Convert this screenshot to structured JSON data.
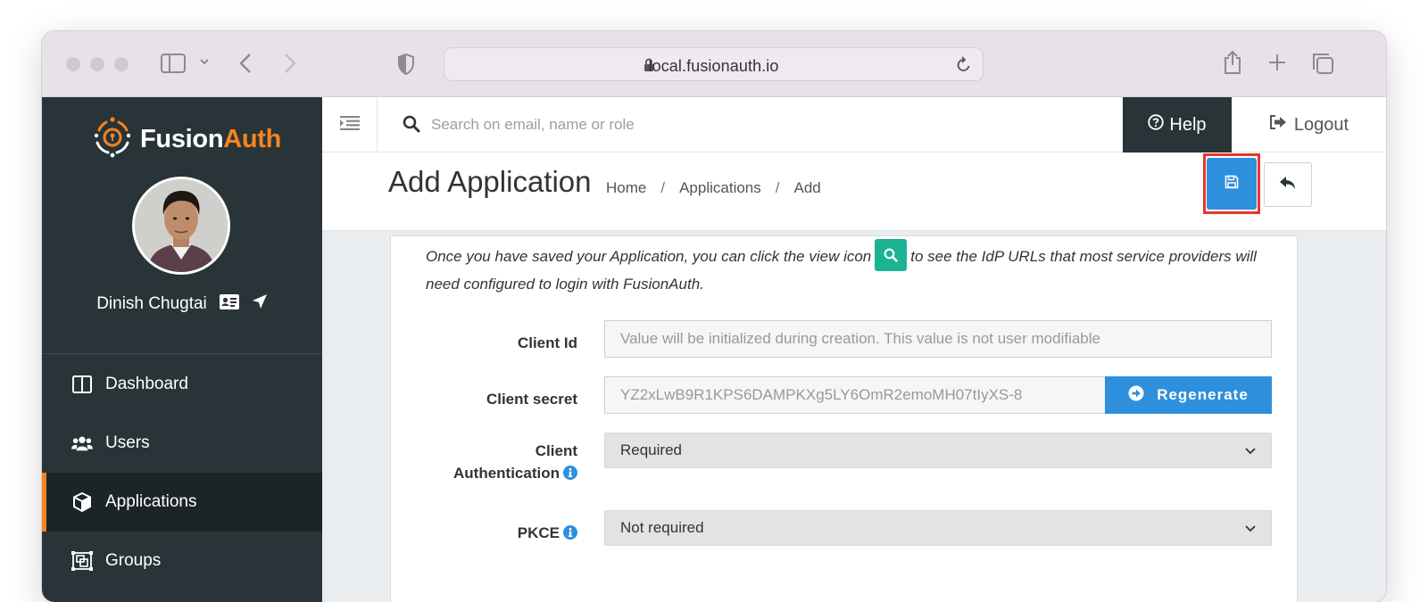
{
  "browser": {
    "url": "local.fusionauth.io"
  },
  "app": {
    "logo_prefix": "Fusion",
    "logo_suffix": "Auth",
    "brand_color": "#f58320",
    "sidebar_color": "#283437"
  },
  "sidebar": {
    "user_name": "Dinish Chugtai",
    "items": [
      {
        "label": "Dashboard",
        "icon": "columns-icon",
        "active": false
      },
      {
        "label": "Users",
        "icon": "users-icon",
        "active": false
      },
      {
        "label": "Applications",
        "icon": "cube-icon",
        "active": true
      },
      {
        "label": "Groups",
        "icon": "object-group-icon",
        "active": false
      }
    ]
  },
  "topbar": {
    "search_placeholder": "Search on email, name or role",
    "help_label": "Help",
    "logout_label": "Logout"
  },
  "page": {
    "title": "Add Application",
    "breadcrumbs": [
      "Home",
      "Applications",
      "Add"
    ],
    "crumb_separator": "/"
  },
  "form": {
    "info_before": "Once you have saved your Application, you can click the view icon",
    "info_after": "to see the IdP URLs that most service providers will need configured to login with FusionAuth.",
    "client_id_label": "Client Id",
    "client_id_placeholder": "Value will be initialized during creation. This value is not user modifiable",
    "client_secret_label": "Client secret",
    "client_secret_value": "YZ2xLwB9R1KPS6DAMPKXg5LY6OmR2emoMH07tIyXS-8",
    "regenerate_label": "Regenerate",
    "client_auth_label_line1": "Client",
    "client_auth_label_line2": "Authentication",
    "client_auth_value": "Required",
    "pkce_label": "PKCE",
    "pkce_value": "Not required"
  }
}
